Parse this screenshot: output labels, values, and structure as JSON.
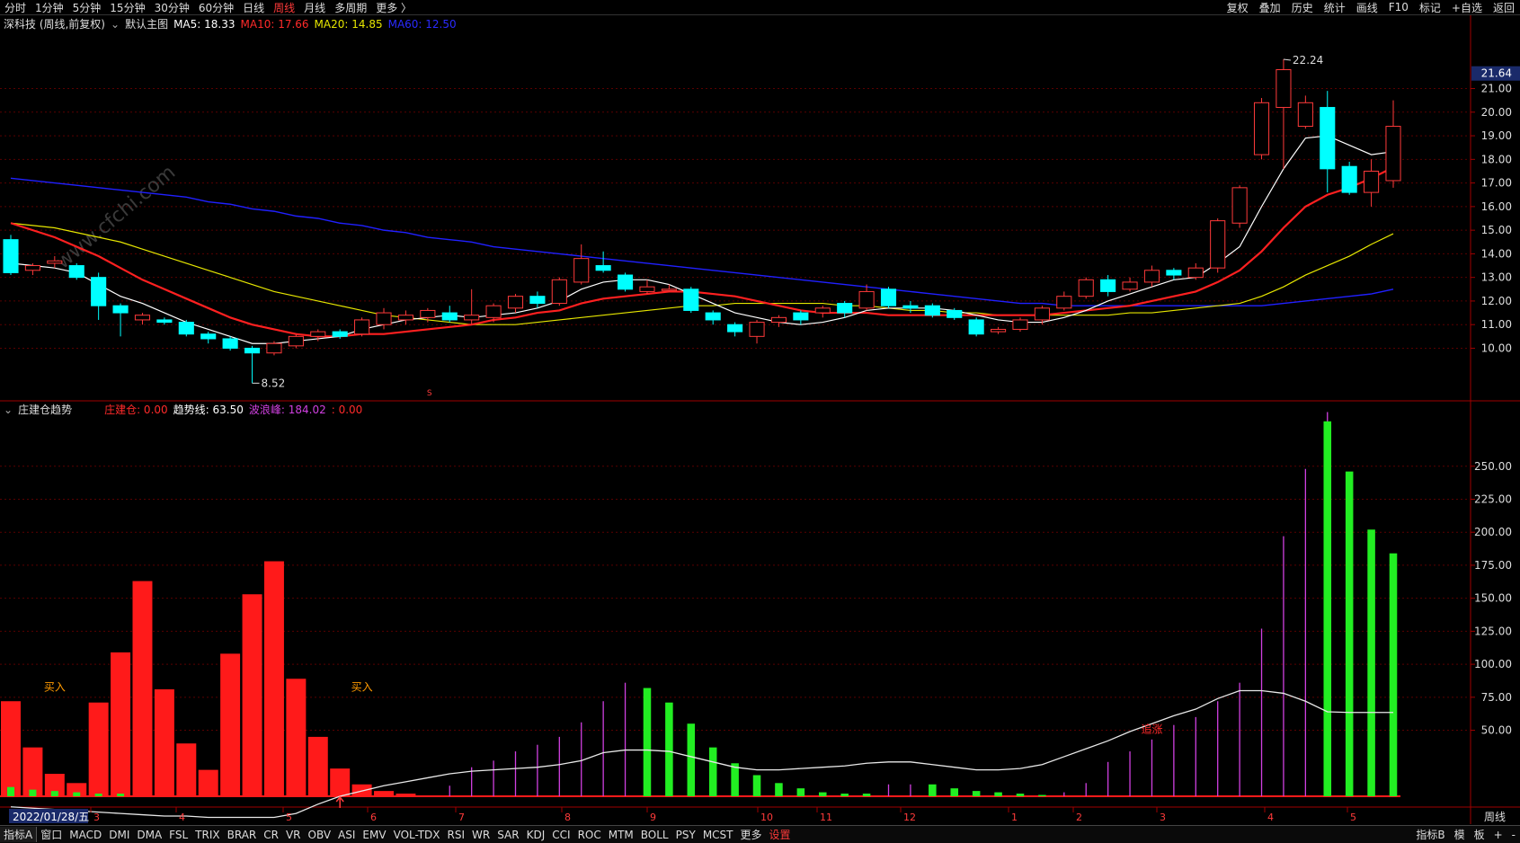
{
  "topbar": {
    "items": [
      "分时",
      "1分钟",
      "5分钟",
      "15分钟",
      "30分钟",
      "60分钟",
      "日线",
      "周线",
      "月线",
      "多周期",
      "更多 〉"
    ],
    "active_index": 7,
    "right_items": [
      "复权",
      "叠加",
      "历史",
      "统计",
      "画线",
      "F10",
      "标记",
      "+自选",
      "返回"
    ]
  },
  "main_legend": {
    "stock": "深科技 (周线,前复权)",
    "indicator": "默认主图",
    "ma5": "MA5: 18.33",
    "ma10": "MA10: 17.66",
    "ma20": "MA20: 14.85",
    "ma60": "MA60: 12.50"
  },
  "sub_legend": {
    "name": "庄建仓趋势",
    "jc": "庄建仓: 0.00",
    "trend": "趋势线: 63.50",
    "wave": "波浪峰: 184.02",
    "extra": ": 0.00"
  },
  "price_axis": {
    "current": "21.64",
    "ticks": [
      "21.00",
      "20.00",
      "19.00",
      "18.00",
      "17.00",
      "16.00",
      "15.00",
      "14.00",
      "13.00",
      "12.00",
      "11.00",
      "10.00"
    ]
  },
  "sub_axis": {
    "ticks": [
      "250.00",
      "225.00",
      "200.00",
      "175.00",
      "150.00",
      "125.00",
      "100.00",
      "75.00",
      "50.00"
    ]
  },
  "annotations": {
    "high": "22.24",
    "low": "8.52",
    "buy1": "买入",
    "buy2": "买入",
    "chase": "追涨",
    "s_mark": "S"
  },
  "time_axis": {
    "date": "2022/01/28/五",
    "months": [
      "3",
      "4",
      "5",
      "6",
      "7",
      "8",
      "9",
      "10",
      "11",
      "12",
      "1",
      "2",
      "3",
      "4",
      "5"
    ],
    "period": "周线"
  },
  "bottombar": {
    "tabs": [
      "指标A",
      "窗口",
      "MACD",
      "DMI",
      "DMA",
      "FSL",
      "TRIX",
      "BRAR",
      "CR",
      "VR",
      "OBV",
      "ASI",
      "EMV",
      "VOL-TDX",
      "RSI",
      "WR",
      "SAR",
      "KDJ",
      "CCI",
      "ROC",
      "MTM",
      "BOLL",
      "PSY",
      "MCST",
      "更多",
      "设置"
    ],
    "right": [
      "指标B",
      "模",
      "板",
      "+",
      "-"
    ]
  },
  "watermark": "www.cfchi.com",
  "colors": {
    "up": "#ff3a3a",
    "down": "#00ffff",
    "ma5": "#ffffff",
    "ma10": "#ff2020",
    "ma20": "#e6e600",
    "ma60": "#2020ff",
    "bar_red": "#ff1a1a",
    "bar_green": "#22ee22",
    "magenta": "#d040e0"
  },
  "chart_data": {
    "type": "candlestick",
    "candles": [
      [
        14.6,
        13.2,
        14.8,
        13.1
      ],
      [
        13.3,
        13.5,
        13.6,
        13.1
      ],
      [
        13.6,
        13.7,
        13.9,
        13.4
      ],
      [
        13.5,
        13.0,
        13.6,
        12.9
      ],
      [
        13.0,
        11.8,
        13.2,
        11.2
      ],
      [
        11.8,
        11.5,
        11.9,
        10.5
      ],
      [
        11.2,
        11.4,
        11.5,
        11.0
      ],
      [
        11.2,
        11.1,
        11.3,
        11.0
      ],
      [
        11.1,
        10.6,
        11.2,
        10.5
      ],
      [
        10.6,
        10.4,
        10.7,
        10.2
      ],
      [
        10.4,
        10.0,
        10.5,
        9.9
      ],
      [
        10.0,
        9.8,
        10.1,
        8.52
      ],
      [
        9.8,
        10.2,
        10.3,
        9.7
      ],
      [
        10.1,
        10.5,
        10.6,
        10.0
      ],
      [
        10.5,
        10.7,
        10.8,
        10.3
      ],
      [
        10.7,
        10.5,
        10.8,
        10.4
      ],
      [
        10.6,
        11.2,
        11.3,
        10.5
      ],
      [
        11.0,
        11.5,
        11.7,
        10.8
      ],
      [
        11.2,
        11.4,
        11.6,
        11.0
      ],
      [
        11.3,
        11.6,
        11.7,
        11.1
      ],
      [
        11.5,
        11.2,
        11.8,
        11.1
      ],
      [
        11.2,
        11.4,
        12.5,
        11.0
      ],
      [
        11.3,
        11.8,
        11.9,
        11.1
      ],
      [
        11.7,
        12.2,
        12.3,
        11.5
      ],
      [
        12.2,
        11.9,
        12.4,
        11.7
      ],
      [
        11.9,
        12.9,
        13.0,
        11.8
      ],
      [
        12.8,
        13.8,
        14.4,
        12.7
      ],
      [
        13.5,
        13.3,
        14.1,
        13.2
      ],
      [
        13.1,
        12.5,
        13.2,
        12.4
      ],
      [
        12.4,
        12.6,
        12.9,
        12.3
      ],
      [
        12.5,
        12.5,
        12.7,
        12.4
      ],
      [
        12.5,
        11.6,
        12.6,
        11.5
      ],
      [
        11.5,
        11.2,
        11.6,
        11.0
      ],
      [
        11.0,
        10.7,
        11.1,
        10.5
      ],
      [
        10.5,
        11.1,
        11.2,
        10.2
      ],
      [
        11.1,
        11.3,
        11.4,
        10.9
      ],
      [
        11.5,
        11.2,
        11.6,
        11.0
      ],
      [
        11.5,
        11.7,
        11.8,
        11.3
      ],
      [
        11.9,
        11.5,
        12.0,
        11.3
      ],
      [
        11.7,
        12.4,
        12.7,
        11.6
      ],
      [
        12.5,
        11.8,
        12.6,
        11.7
      ],
      [
        11.8,
        11.7,
        12.0,
        11.5
      ],
      [
        11.8,
        11.4,
        11.9,
        11.3
      ],
      [
        11.6,
        11.3,
        11.7,
        11.2
      ],
      [
        11.2,
        10.6,
        11.3,
        10.5
      ],
      [
        10.7,
        10.8,
        10.9,
        10.6
      ],
      [
        10.8,
        11.2,
        11.3,
        10.7
      ],
      [
        11.2,
        11.7,
        11.8,
        11.0
      ],
      [
        11.7,
        12.2,
        12.4,
        11.6
      ],
      [
        12.2,
        12.9,
        13.0,
        12.1
      ],
      [
        12.9,
        12.4,
        13.1,
        12.2
      ],
      [
        12.5,
        12.8,
        13.0,
        12.4
      ],
      [
        12.8,
        13.3,
        13.5,
        12.6
      ],
      [
        13.3,
        13.1,
        13.4,
        12.9
      ],
      [
        13.0,
        13.4,
        13.6,
        12.9
      ],
      [
        13.4,
        15.4,
        15.5,
        13.2
      ],
      [
        15.3,
        16.8,
        16.9,
        15.1
      ],
      [
        18.2,
        20.4,
        20.6,
        18.0
      ],
      [
        20.2,
        21.8,
        22.24,
        17.6
      ],
      [
        19.4,
        20.4,
        20.7,
        19.3
      ],
      [
        20.2,
        17.6,
        20.9,
        16.6
      ],
      [
        17.7,
        16.6,
        17.9,
        16.5
      ],
      [
        16.6,
        17.5,
        18.0,
        16.0
      ],
      [
        17.1,
        19.4,
        20.5,
        16.8
      ]
    ],
    "ma5": [
      13.6,
      13.5,
      13.4,
      13.2,
      12.7,
      12.2,
      11.9,
      11.5,
      11.1,
      10.8,
      10.5,
      10.2,
      10.2,
      10.3,
      10.4,
      10.5,
      10.8,
      11.0,
      11.2,
      11.3,
      11.4,
      11.3,
      11.4,
      11.5,
      11.7,
      12.0,
      12.5,
      12.8,
      12.9,
      12.9,
      12.7,
      12.3,
      11.9,
      11.5,
      11.3,
      11.1,
      11.0,
      11.1,
      11.3,
      11.6,
      11.7,
      11.7,
      11.7,
      11.6,
      11.4,
      11.2,
      11.1,
      11.1,
      11.3,
      11.6,
      12.0,
      12.3,
      12.6,
      12.9,
      13.0,
      13.6,
      14.3,
      16.0,
      17.6,
      18.9,
      19.0,
      18.6,
      18.2,
      18.33
    ],
    "ma10": [
      15.3,
      15.0,
      14.7,
      14.3,
      13.9,
      13.4,
      12.9,
      12.5,
      12.1,
      11.7,
      11.3,
      11.0,
      10.8,
      10.6,
      10.5,
      10.5,
      10.6,
      10.6,
      10.7,
      10.8,
      10.9,
      11.0,
      11.2,
      11.3,
      11.5,
      11.6,
      11.9,
      12.1,
      12.2,
      12.3,
      12.4,
      12.4,
      12.3,
      12.2,
      12.0,
      11.8,
      11.6,
      11.5,
      11.5,
      11.5,
      11.4,
      11.4,
      11.4,
      11.4,
      11.4,
      11.4,
      11.4,
      11.4,
      11.5,
      11.6,
      11.7,
      11.8,
      12.0,
      12.2,
      12.4,
      12.8,
      13.3,
      14.1,
      15.1,
      16.0,
      16.5,
      16.8,
      17.2,
      17.66
    ],
    "ma20": [
      15.3,
      15.2,
      15.1,
      14.9,
      14.7,
      14.5,
      14.2,
      13.9,
      13.6,
      13.3,
      13.0,
      12.7,
      12.4,
      12.2,
      12.0,
      11.8,
      11.6,
      11.4,
      11.3,
      11.2,
      11.1,
      11.0,
      11.0,
      11.0,
      11.1,
      11.2,
      11.3,
      11.4,
      11.5,
      11.6,
      11.7,
      11.8,
      11.8,
      11.9,
      11.9,
      11.9,
      11.9,
      11.9,
      11.8,
      11.8,
      11.7,
      11.6,
      11.6,
      11.5,
      11.5,
      11.4,
      11.4,
      11.4,
      11.4,
      11.4,
      11.4,
      11.5,
      11.5,
      11.6,
      11.7,
      11.8,
      11.9,
      12.2,
      12.6,
      13.1,
      13.5,
      13.9,
      14.4,
      14.85
    ],
    "ma60": [
      17.2,
      17.1,
      17.0,
      16.9,
      16.8,
      16.7,
      16.6,
      16.5,
      16.4,
      16.2,
      16.1,
      15.9,
      15.8,
      15.6,
      15.5,
      15.3,
      15.2,
      15.0,
      14.9,
      14.7,
      14.6,
      14.5,
      14.3,
      14.2,
      14.1,
      14.0,
      13.9,
      13.8,
      13.7,
      13.6,
      13.5,
      13.4,
      13.3,
      13.2,
      13.1,
      13.0,
      12.9,
      12.8,
      12.7,
      12.6,
      12.5,
      12.4,
      12.3,
      12.2,
      12.1,
      12.0,
      11.9,
      11.9,
      11.8,
      11.8,
      11.8,
      11.8,
      11.8,
      11.8,
      11.8,
      11.8,
      11.8,
      11.8,
      11.9,
      12.0,
      12.1,
      12.2,
      12.3,
      12.5
    ],
    "red_bars": [
      72,
      37,
      17,
      10,
      71,
      109,
      163,
      81,
      40,
      20,
      108,
      153,
      178,
      89,
      45,
      21,
      9,
      4,
      2,
      0
    ],
    "green_bars": [
      {
        "i": 29,
        "v": 82
      },
      {
        "i": 30,
        "v": 71
      },
      {
        "i": 31,
        "v": 55
      },
      {
        "i": 32,
        "v": 37
      },
      {
        "i": 33,
        "v": 25
      },
      {
        "i": 34,
        "v": 16
      },
      {
        "i": 35,
        "v": 10
      },
      {
        "i": 36,
        "v": 6
      },
      {
        "i": 37,
        "v": 3
      },
      {
        "i": 38,
        "v": 2
      },
      {
        "i": 39,
        "v": 2
      },
      {
        "i": 42,
        "v": 9
      },
      {
        "i": 43,
        "v": 6
      },
      {
        "i": 44,
        "v": 4
      },
      {
        "i": 45,
        "v": 3
      },
      {
        "i": 46,
        "v": 2
      },
      {
        "i": 47,
        "v": 1
      },
      {
        "i": 60,
        "v": 284
      },
      {
        "i": 61,
        "v": 246
      },
      {
        "i": 62,
        "v": 202
      },
      {
        "i": 63,
        "v": 184
      }
    ],
    "magenta_lines": [
      {
        "i": 20,
        "v": 8
      },
      {
        "i": 21,
        "v": 22
      },
      {
        "i": 22,
        "v": 27
      },
      {
        "i": 23,
        "v": 34
      },
      {
        "i": 24,
        "v": 39
      },
      {
        "i": 25,
        "v": 45
      },
      {
        "i": 26,
        "v": 56
      },
      {
        "i": 27,
        "v": 72
      },
      {
        "i": 28,
        "v": 86
      },
      {
        "i": 40,
        "v": 9
      },
      {
        "i": 41,
        "v": 9
      },
      {
        "i": 48,
        "v": 3
      },
      {
        "i": 49,
        "v": 10
      },
      {
        "i": 50,
        "v": 26
      },
      {
        "i": 51,
        "v": 34
      },
      {
        "i": 52,
        "v": 43
      },
      {
        "i": 53,
        "v": 54
      },
      {
        "i": 54,
        "v": 60
      },
      {
        "i": 55,
        "v": 72
      },
      {
        "i": 56,
        "v": 86
      },
      {
        "i": 57,
        "v": 127
      },
      {
        "i": 58,
        "v": 197
      },
      {
        "i": 59,
        "v": 248
      },
      {
        "i": 60,
        "v": 291
      }
    ],
    "trend_line": [
      -8,
      -9,
      -10,
      -11,
      -12,
      -13,
      -14,
      -15,
      -15,
      -16,
      -16,
      -16,
      -16,
      -13,
      -6,
      0,
      4,
      8,
      11,
      14,
      17,
      19,
      20,
      21,
      22,
      24,
      27,
      33,
      35,
      35,
      34,
      30,
      26,
      22,
      20,
      20,
      21,
      22,
      23,
      25,
      26,
      26,
      24,
      22,
      20,
      20,
      21,
      24,
      30,
      36,
      42,
      49,
      55,
      61,
      66,
      74,
      80,
      80,
      78,
      72,
      64,
      63.5,
      63.5,
      63.5
    ],
    "markers": {
      "buy1_index": 2,
      "buy2_index": 16,
      "chase_index": 52,
      "s_index": 19
    },
    "price_range": [
      8.0,
      23.0
    ],
    "sub_range": [
      0,
      290
    ]
  }
}
